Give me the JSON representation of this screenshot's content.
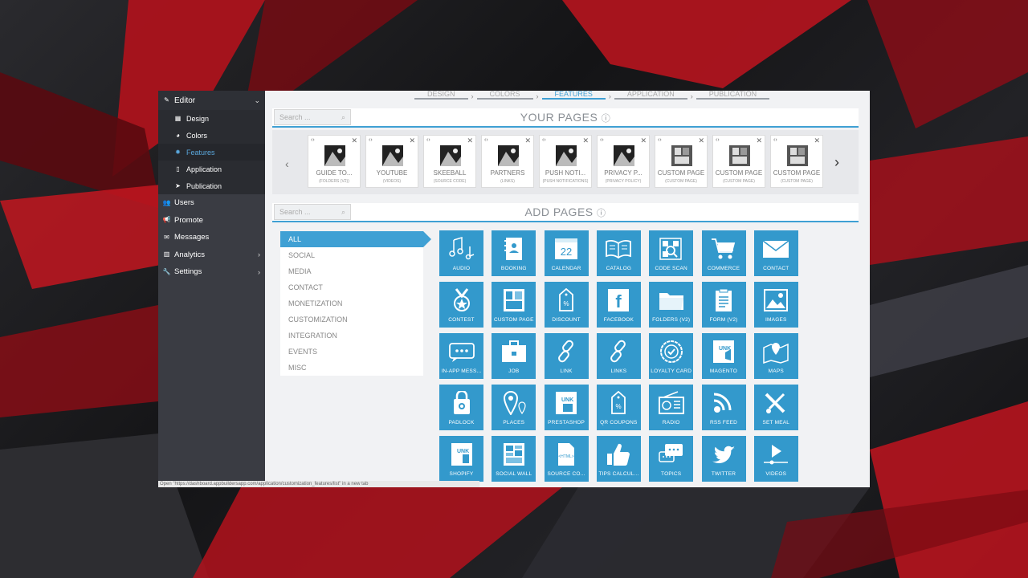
{
  "sidebar": {
    "header": "Editor",
    "sub_items": [
      {
        "label": "Design",
        "icon": "grid-icon"
      },
      {
        "label": "Colors",
        "icon": "palette-icon"
      },
      {
        "label": "Features",
        "icon": "cog-icon"
      },
      {
        "label": "Application",
        "icon": "phone-icon"
      },
      {
        "label": "Publication",
        "icon": "send-icon"
      }
    ],
    "main_items": [
      {
        "label": "Users",
        "icon": "users-icon"
      },
      {
        "label": "Promote",
        "icon": "megaphone-icon"
      },
      {
        "label": "Messages",
        "icon": "envelope-icon"
      },
      {
        "label": "Analytics",
        "icon": "chart-icon"
      },
      {
        "label": "Settings",
        "icon": "wrench-icon"
      }
    ]
  },
  "steps": [
    "DESIGN",
    "COLORS",
    "FEATURES",
    "APPLICATION",
    "PUBLICATION"
  ],
  "your_pages": {
    "title": "YOUR PAGES",
    "search_placeholder": "Search ...",
    "cards": [
      {
        "name": "GUIDE TO...",
        "sub": "(FOLDERS (V2))"
      },
      {
        "name": "YOUTUBE",
        "sub": "(VIDEOS)"
      },
      {
        "name": "SKEEBALL",
        "sub": "(SOURCE CODE)"
      },
      {
        "name": "PARTNERS",
        "sub": "(LINKS)"
      },
      {
        "name": "PUSH NOTI...",
        "sub": "(PUSH NOTIFICATIONS)"
      },
      {
        "name": "PRIVACY P...",
        "sub": "(PRIVACY POLICY)"
      },
      {
        "name": "CUSTOM PAGE",
        "sub": "(CUSTOM PAGE)"
      },
      {
        "name": "CUSTOM PAGE",
        "sub": "(CUSTOM PAGE)"
      },
      {
        "name": "CUSTOM PAGE",
        "sub": "(CUSTOM PAGE)"
      }
    ]
  },
  "add_pages": {
    "title": "ADD PAGES",
    "search_placeholder": "Search ...",
    "categories": [
      "ALL",
      "SOCIAL",
      "MEDIA",
      "CONTACT",
      "MONETIZATION",
      "CUSTOMIZATION",
      "INTEGRATION",
      "EVENTS",
      "MISC"
    ],
    "features": [
      "AUDIO",
      "BOOKING",
      "CALENDAR",
      "CATALOG",
      "CODE SCAN",
      "COMMERCE",
      "CONTACT",
      "CONTEST",
      "CUSTOM PAGE",
      "DISCOUNT",
      "FACEBOOK",
      "FOLDERS (V2)",
      "FORM (V2)",
      "IMAGES",
      "IN-APP MESS...",
      "JOB",
      "LINK",
      "LINKS",
      "LOYALTY CARD",
      "MAGENTO",
      "MAPS",
      "PADLOCK",
      "PLACES",
      "PRESTASHOP",
      "QR COUPONS",
      "RADIO",
      "RSS FEED",
      "SET MEAL",
      "SHOPIFY",
      "SOCIAL WALL",
      "SOURCE CO...",
      "TIPS CALCUL...",
      "TOPICS",
      "TWITTER",
      "VIDEOS"
    ],
    "calendar_day": "22"
  },
  "statusbar": "Open \"https://dashboard.appbuildersapp.com/application/customization_features/list\" in a new tab",
  "colors": {
    "accent": "#3fa0d4",
    "tile": "#3399cc",
    "sidebar": "#3a3c43"
  }
}
